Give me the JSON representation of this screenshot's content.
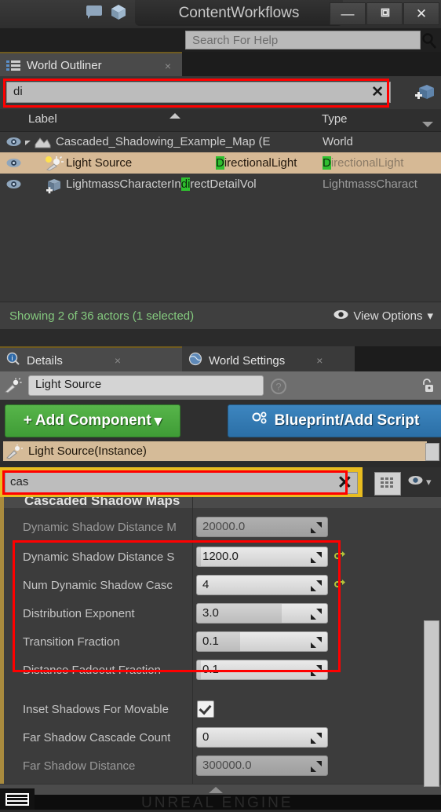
{
  "titlebar": {
    "project_title": "ContentWorkflows",
    "icons": [
      "chat-bubble-icon",
      "unreal-cube-icon"
    ],
    "minimize_label": "—",
    "restore_label": "❐",
    "close_label": "✕"
  },
  "help": {
    "placeholder": "Search For Help",
    "value": "",
    "search_icon": "magnifier-icon"
  },
  "outliner": {
    "tab_label": "World Outliner",
    "tab_close": "×",
    "search_value": "di",
    "search_clear": "✕",
    "add_button_icon": "add-actor-icon",
    "columns": {
      "label": "Label",
      "type": "Type"
    },
    "rows": [
      {
        "name": "Cascaded_Shadowing_Example_Map (E",
        "type_suffix": "World",
        "selected": false,
        "expandable": true,
        "icon": "level-icon",
        "visible_icon": "eye-icon"
      },
      {
        "name": "Light Source",
        "type_pre": "D",
        "type_hl": "D",
        "type_rest": "irectionalLight",
        "type_col_pre": "D",
        "type_col_rest": "irectionalLight",
        "selected": true,
        "expandable": false,
        "icon": "directional-light-icon",
        "visible_icon": "eye-icon"
      },
      {
        "name_pre": "LightmassCharacterIn",
        "name_hl": "di",
        "name_post": "rectDetailVol",
        "type_text": "LightmassCharact",
        "selected": false,
        "expandable": false,
        "icon": "volume-icon",
        "visible_icon": "eye-icon"
      }
    ],
    "status_text": "Showing 2 of 36 actors (1 selected)",
    "view_options_label": "View Options",
    "view_options_icon": "eye-icon",
    "view_options_caret": "▾"
  },
  "details": {
    "tabs": [
      {
        "label": "Details",
        "icon": "details-info-icon",
        "close": "×",
        "active": true
      },
      {
        "label": "World Settings",
        "icon": "globe-icon",
        "close": "×",
        "active": false
      }
    ],
    "name_field_value": "Light Source",
    "name_field_icon": "light-wand-icon",
    "help_icon": "question-icon",
    "lock_icon": "unlock-icon",
    "add_component_label": "Add Component",
    "add_component_plus": "+",
    "add_component_caret": "▾",
    "blueprint_label": "Blueprint/Add Script",
    "blueprint_icon": "blueprint-gears-icon",
    "instance_label": "Light Source(Instance)",
    "instance_icon": "light-wand-icon",
    "property_search_value": "cas",
    "property_search_clear": "✕",
    "grid_view_icon": "grid-view-icon",
    "eye_icon": "eye-icon",
    "eye_caret": "▾",
    "category_header": "Cascaded Shadow Maps"
  },
  "properties": [
    {
      "name": "Dynamic Shadow Distance M",
      "value": "20000.0",
      "control": "spinner",
      "readonly": true,
      "fill_pct": 0,
      "reset": false,
      "highlighted": false
    },
    {
      "name": "Dynamic Shadow Distance S",
      "value": "1200.0",
      "control": "spinner",
      "readonly": false,
      "fill_pct": 3,
      "reset": true,
      "highlighted": true
    },
    {
      "name": "Num Dynamic Shadow Casc",
      "value": "4",
      "control": "spinner",
      "readonly": false,
      "fill_pct": 0,
      "reset": true,
      "highlighted": true
    },
    {
      "name": "Distribution Exponent",
      "value": "3.0",
      "control": "spinner",
      "readonly": false,
      "fill_pct": 65,
      "reset": false,
      "highlighted": true
    },
    {
      "name": "Transition Fraction",
      "value": "0.1",
      "control": "spinner",
      "readonly": false,
      "fill_pct": 33,
      "reset": false,
      "highlighted": true
    },
    {
      "name": "Distance Fadeout Fraction",
      "value": "0.1",
      "control": "spinner",
      "readonly": false,
      "fill_pct": 3,
      "reset": false,
      "highlighted": true
    },
    {
      "name": "Inset Shadows For Movable",
      "value": true,
      "control": "checkbox",
      "readonly": false,
      "fill_pct": 0,
      "reset": false,
      "highlighted": false
    },
    {
      "name": "Far Shadow Cascade Count",
      "value": "0",
      "control": "spinner",
      "readonly": false,
      "fill_pct": 0,
      "reset": false,
      "highlighted": false
    },
    {
      "name": "Far Shadow Distance",
      "value": "300000.0",
      "control": "spinner",
      "readonly": true,
      "fill_pct": 0,
      "reset": false,
      "highlighted": false
    }
  ],
  "taskbar": {
    "start_icon": "start-menu-icon",
    "watermark": "UNREAL ENGINE",
    "clock": ""
  },
  "colors": {
    "highlight_red": "#ff0000",
    "selection_tan": "#d6b995",
    "search_match_green": "#2fbf2f",
    "add_component_green": "#3f9c36",
    "blueprint_blue": "#2b6fa6",
    "search_focus_yellow": "#e8bc20",
    "status_green": "#84c97e",
    "panel_accent_gold": "#a98b3e"
  }
}
